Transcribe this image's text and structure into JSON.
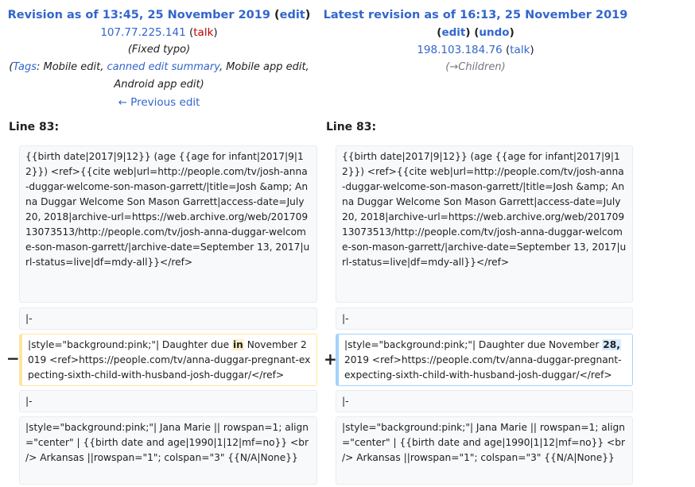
{
  "left": {
    "title_prefix": "Revision as of 13:45, 25 November 2019",
    "edit": "edit",
    "user": "107.77.225.141",
    "talk": "talk",
    "summary": "(Fixed typo)",
    "tags_open": "(",
    "tags_label": "Tags",
    "tags_colon": ":",
    "tag1": "Mobile edit,",
    "tag2": "canned edit summary",
    "tag3": ", Mobile app edit,",
    "tag4": "Android app edit)",
    "prev": "← Previous edit",
    "lineno": "Line 83:"
  },
  "right": {
    "title": "Latest revision as of 16:13, 25 November 2019",
    "edit": "edit",
    "undo": "undo",
    "user": "198.103.184.76",
    "talk": "talk",
    "summary_arrow": "→Children",
    "lineno": "Line 83:"
  },
  "rows": {
    "ctx1": "{{birth date|2017|9|12}} (age {{age for infant|2017|9|12}}) <ref>{{cite web|url=http://people.com/tv/josh-anna-duggar-welcome-son-mason-garrett/|title=Josh &amp; Anna Duggar Welcome Son Mason Garrett|access-date=July 20, 2018|archive-url=https://web.archive.org/web/20170913073513/http://people.com/tv/josh-anna-duggar-welcome-son-mason-garrett/|archive-date=September 13, 2017|url-status=live|df=mdy-all}}</ref>",
    "ctx2": "|-",
    "del_before": "|style=\"background:pink;\"| Daughter due ",
    "del_hl": "in",
    "del_after": " November 2019 <ref>https://people.com/tv/anna-duggar-pregnant-expecting-sixth-child-with-husband-josh-duggar/</ref>",
    "add_before": "|style=\"background:pink;\"| Daughter due November ",
    "add_hl": "28,",
    "add_after": " 2019 <ref>https://people.com/tv/anna-duggar-pregnant-expecting-sixth-child-with-husband-josh-duggar/</ref>",
    "ctx3": "|-",
    "ctx4": "|style=\"background:pink;\"| Jana Marie || rowspan=1; align=\"center\" | {{birth date and age|1990|1|12|mf=no}} <br /> Arkansas ||rowspan=\"1\"; colspan=\"3\" {{N/A|None}}",
    "minus": "−",
    "plus": "+"
  }
}
